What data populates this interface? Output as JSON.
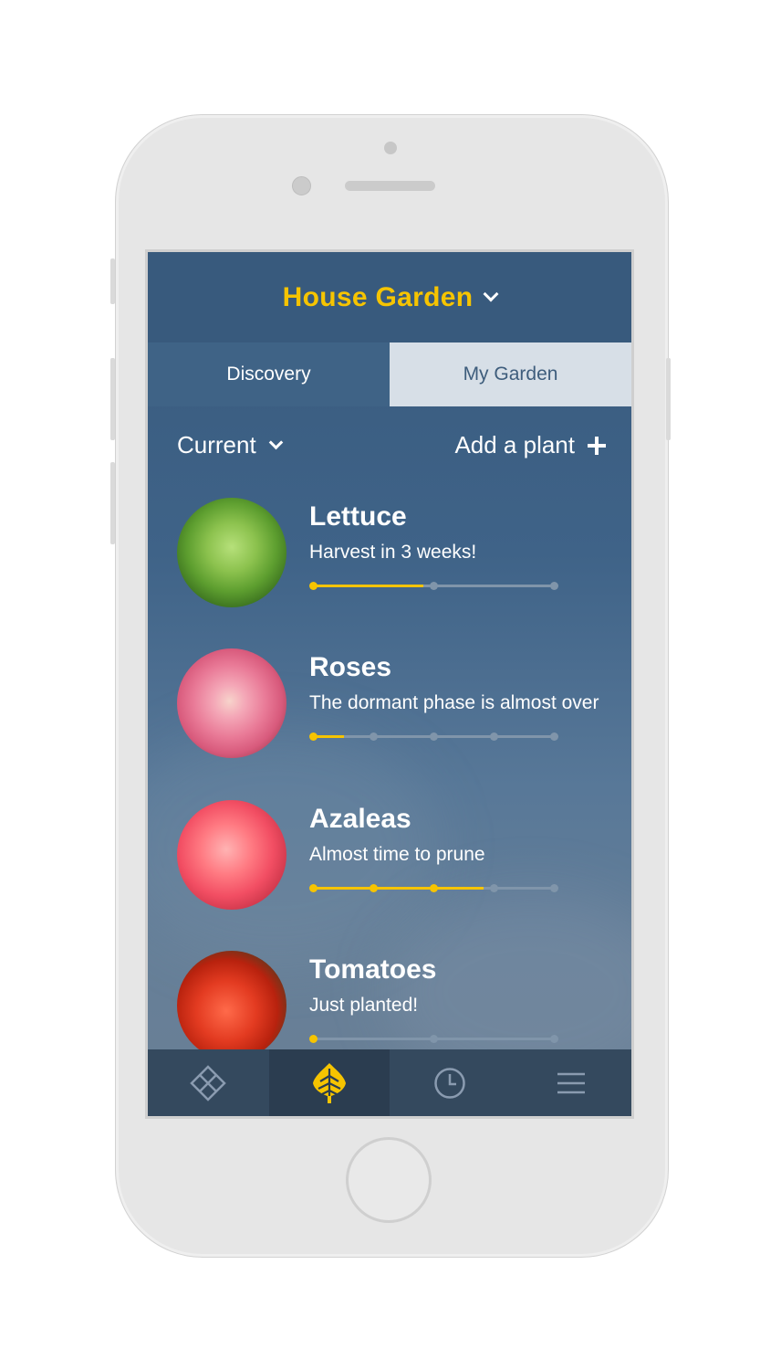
{
  "header": {
    "title": "House Garden"
  },
  "tabs": [
    {
      "label": "Discovery",
      "active": false
    },
    {
      "label": "My Garden",
      "active": true
    }
  ],
  "toolbar": {
    "filter_label": "Current",
    "add_label": "Add a plant"
  },
  "plants": [
    {
      "name": "Lettuce",
      "status": "Harvest in 3 weeks!",
      "stages": 3,
      "progress_fraction": 0.46
    },
    {
      "name": "Roses",
      "status": "The dormant phase is almost over",
      "stages": 5,
      "progress_fraction": 0.13
    },
    {
      "name": "Azaleas",
      "status": "Almost time to prune",
      "stages": 5,
      "progress_fraction": 0.71
    },
    {
      "name": "Tomatoes",
      "status": "Just planted!",
      "stages": 3,
      "progress_fraction": 0.0
    }
  ],
  "tabbar": {
    "items": [
      {
        "icon": "diamond-grid-icon",
        "active": false
      },
      {
        "icon": "leaf-icon",
        "active": true
      },
      {
        "icon": "clock-icon",
        "active": false
      },
      {
        "icon": "menu-icon",
        "active": false
      }
    ]
  },
  "colors": {
    "accent": "#f6c400",
    "header_bg": "#385a7d",
    "tabbar_bg": "#34495e",
    "track": "#8095aa"
  }
}
